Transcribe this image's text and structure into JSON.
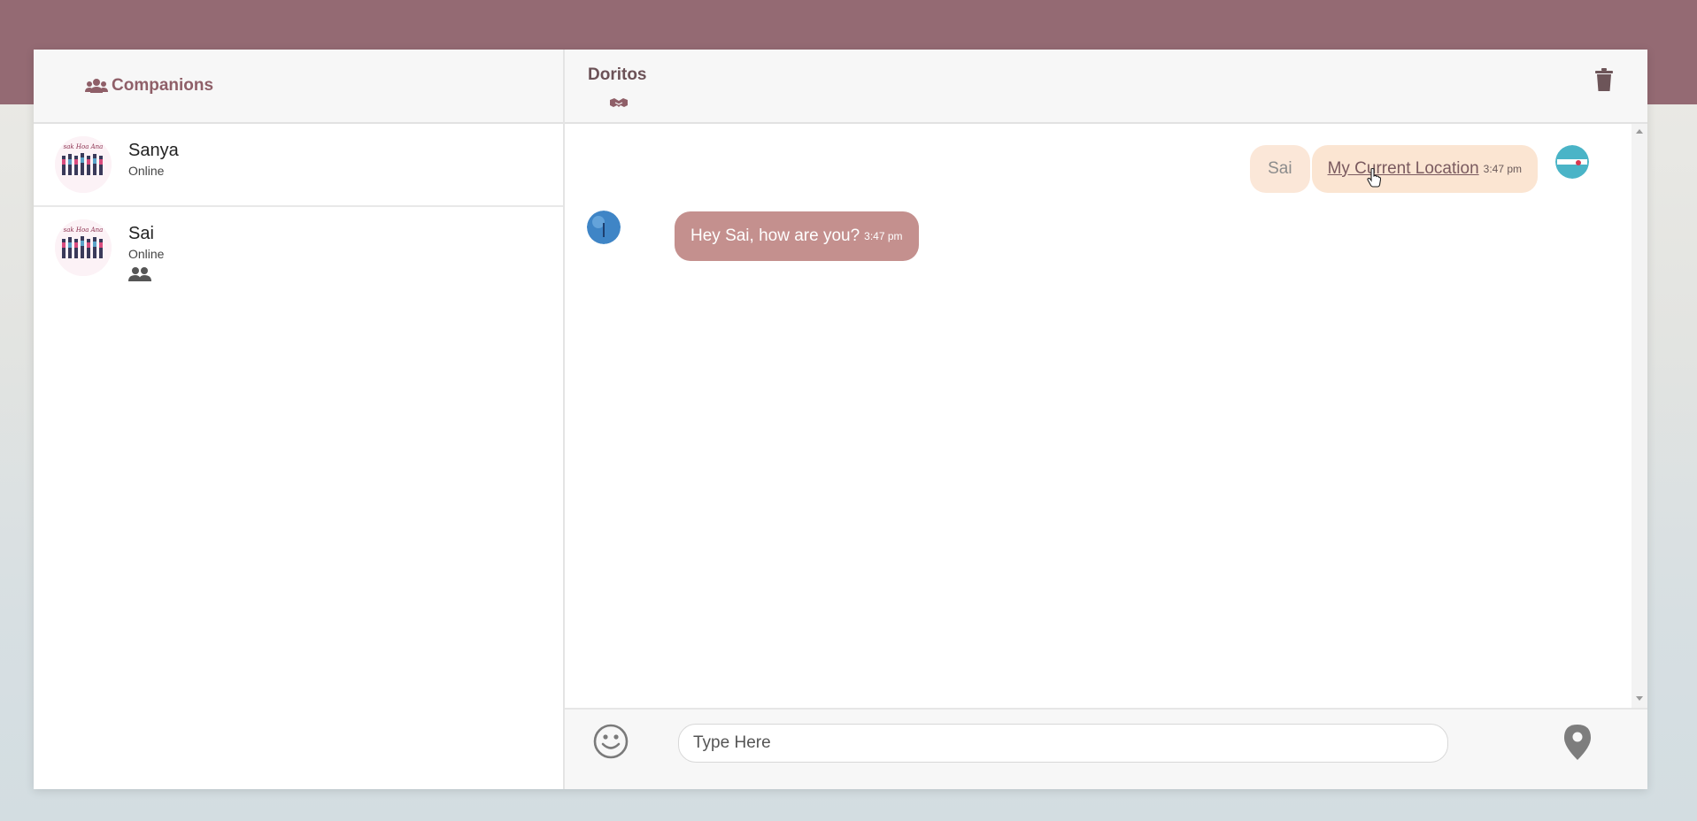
{
  "sidebar": {
    "title": "Companions",
    "contacts": [
      {
        "name": "Sanya",
        "status": "Online",
        "is_group": false
      },
      {
        "name": "Sai",
        "status": "Online",
        "is_group": true
      }
    ]
  },
  "chat": {
    "title": "Doritos",
    "messages": [
      {
        "direction": "out",
        "sender": "Sai",
        "text": "My Current Location",
        "time": "3:47 pm",
        "is_link": true
      },
      {
        "direction": "in",
        "text": "Hey Sai, how are you?",
        "time": "3:47 pm"
      }
    ]
  },
  "composer": {
    "placeholder": "Type Here",
    "value": ""
  },
  "icons": {
    "sidebar_header": "users-icon",
    "chat_header": "handshake-icon",
    "delete": "trash-icon",
    "emoji": "smiley-icon",
    "location": "location-pin-icon"
  },
  "colors": {
    "top_band": "#946a73",
    "accent": "#8f5f68",
    "incoming_bubble": "#c4908e",
    "outgoing_bubble": "#fbe5d2"
  }
}
